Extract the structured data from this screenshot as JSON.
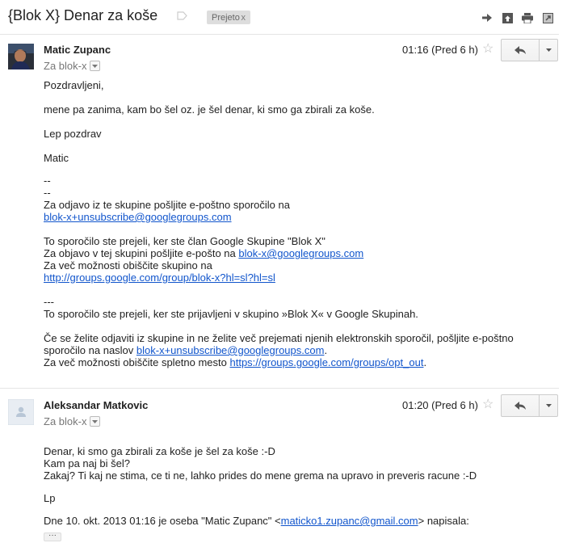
{
  "thread": {
    "subject": "{Blok X} Denar za koše",
    "label": "Prejeto",
    "label_remove": "x"
  },
  "header_actions": [
    "forward-icon",
    "open-new-window-icon",
    "print-icon",
    "expand-icon"
  ],
  "message1": {
    "sender": "Matic Zupanc",
    "to": "Za blok-x",
    "time": "01:16 (Pred 6 h)",
    "body": {
      "greeting": "Pozdravljeni,",
      "p1": "mene pa zanima, kam bo šel oz. je šel denar, ki smo ga zbirali za koše.",
      "closing": "Lep pozdrav",
      "signature": "Matic",
      "sep1": "--",
      "sep2": "--",
      "unsub_text": "Za odjavo iz te skupine pošljite e-poštno sporočilo na",
      "unsub_link": "blok-x+unsubscribe@googlegroups.com",
      "member_text": "To sporočilo ste prejeli, ker ste član Google Skupine \"Blok X\"",
      "post_text": "Za objavo v tej skupini pošljite e-pošto na ",
      "post_link": "blok-x@googlegroups.com",
      "options_text": "Za več možnosti obiščite skupino na",
      "options_link": "http://groups.google.com/group/blok-x?hl=sl?hl=sl",
      "sep3": "---",
      "subscribed_text": "To sporočilo ste prejeli, ker ste prijavljeni v skupino »Blok X« v Google Skupinah.",
      "unsub2_line1": "Če se želite odjaviti iz skupine in ne želite več prejemati njenih elektronskih sporočil, pošljite e-poštno",
      "unsub2_line2_prefix": "sporočilo na naslov ",
      "unsub2_link": "blok-x+unsubscribe@googlegroups.com",
      "unsub2_suffix": ".",
      "web_text": "Za več možnosti obiščite spletno mesto ",
      "web_link": "https://groups.google.com/groups/opt_out",
      "web_suffix": "."
    }
  },
  "message2": {
    "sender": "Aleksandar Matkovic",
    "to": "Za blok-x",
    "time": "01:20 (Pred 6 h)",
    "body": {
      "l1": "Denar,  ki smo ga zbirali za koše je šel za koše :-D",
      "l2": "Kam pa naj bi šel?",
      "l3": "Zakaj?  Ti kaj ne stima,  ce ti ne, lahko prides do mene grema na upravo in preveris racune :-D",
      "l4": "Lp",
      "quote_prefix": "Dne 10. okt. 2013 01:16 je oseba \"Matic Zupanc\" <",
      "quote_link": "maticko1.zupanc@gmail.com",
      "quote_suffix": "> napisala:",
      "show_trimmed": "···"
    }
  }
}
